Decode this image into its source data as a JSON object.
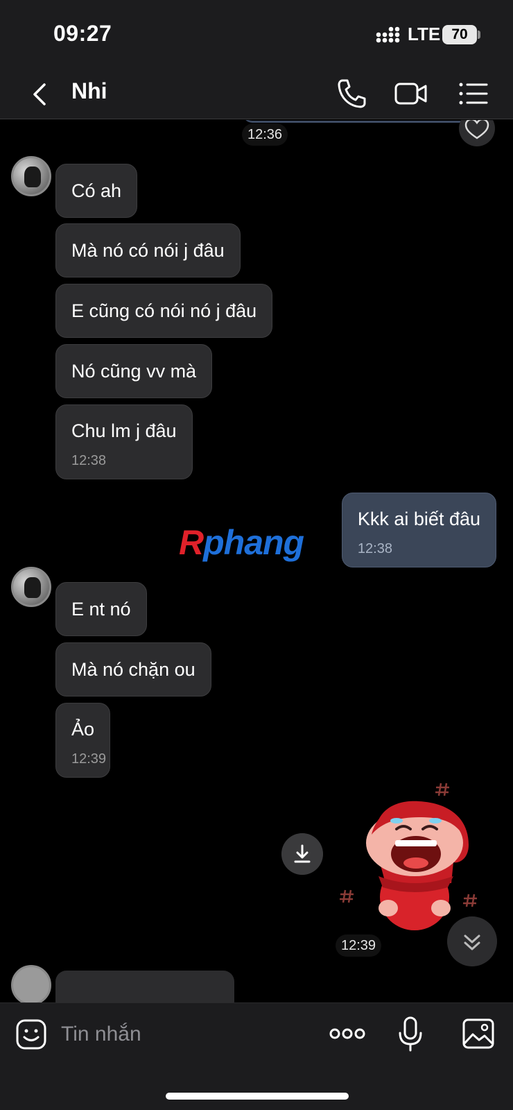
{
  "status_bar": {
    "time": "09:27",
    "network": "LTE",
    "battery": "70"
  },
  "header": {
    "contact_name": "Nhi"
  },
  "conversation": {
    "top_time": "12:36",
    "group1": [
      {
        "text": "Có ah"
      },
      {
        "text": "Mà nó có nói j đâu"
      },
      {
        "text": "E cũng có nói nó j đâu"
      },
      {
        "text": "Nó cũng vv mà"
      },
      {
        "text": "Chu lm j đâu",
        "time": "12:38"
      }
    ],
    "outgoing": {
      "text": "Kkk ai biết đâu",
      "time": "12:38"
    },
    "watermark": {
      "first": "R",
      "rest": "phang"
    },
    "group2": [
      {
        "text": "E nt nó"
      },
      {
        "text": "Mà nó chặn ou"
      },
      {
        "text": "Ảo",
        "time": "12:39"
      }
    ],
    "sticker_time": "12:39"
  },
  "input": {
    "placeholder": "Tin nhắn",
    "value": ""
  },
  "icons": {
    "back": "chevron-left-icon",
    "call": "phone-icon",
    "video": "video-camera-icon",
    "menu": "list-menu-icon",
    "emoji": "emoji-icon",
    "more": "more-dots-icon",
    "mic": "microphone-icon",
    "image": "image-icon",
    "download": "download-icon",
    "scroll": "chevron-double-down-icon",
    "heart": "heart-icon"
  },
  "colors": {
    "background": "#000000",
    "incoming_bubble": "#2c2c2e",
    "outgoing_bubble": "#3b4658",
    "bar": "#1c1c1e"
  }
}
